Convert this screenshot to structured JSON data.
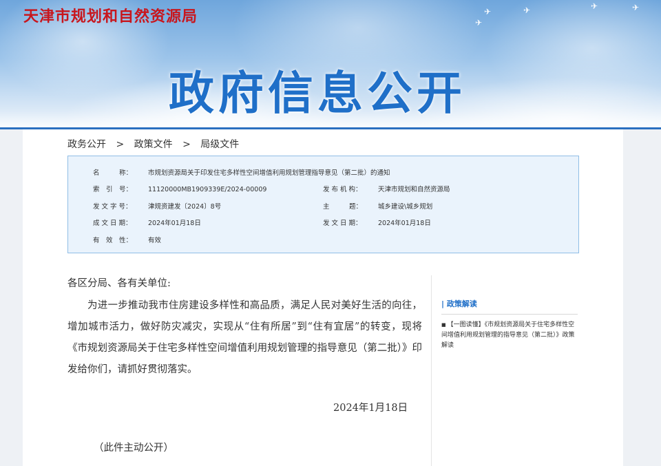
{
  "header": {
    "site_name": "天津市规划和自然资源局",
    "banner_title": "政府信息公开"
  },
  "breadcrumb": {
    "items": [
      "政务公开",
      "政策文件",
      "局级文件"
    ],
    "separator": ">"
  },
  "meta": {
    "name_label": "名　　　称：",
    "name_value": "市规划资源局关于印发住宅多样性空间增值利用规划管理指导意见（第二批）的通知",
    "index_label": "索　引　号：",
    "index_value": "11120000MB1909339E/2024-00009",
    "issuer_label": "发 布 机 构：",
    "issuer_value": "天津市规划和自然资源局",
    "docno_label": "发 文 字 号：",
    "docno_value": "津规资建发〔2024〕8号",
    "subject_label": "主　　　题：",
    "subject_value": "城乡建设\\城乡规划",
    "written_label": "成 文 日 期：",
    "written_value": "2024年01月18日",
    "issued_label": "发 文 日 期：",
    "issued_value": "2024年01月18日",
    "validity_label": "有　效　性：",
    "validity_value": "有效"
  },
  "document": {
    "greeting": "各区分局、各有关单位:",
    "body": "为进一步推动我市住房建设多样性和高品质，满足人民对美好生活的向往，增加城市活力，做好防灾减灾，实现从“住有所居”到“住有宜居”的转变，现将《市规划资源局关于住宅多样性空间增值利用规划管理的指导意见（第二批）》印发给你们，请抓好贯彻落实。",
    "date": "2024年1月18日",
    "public_note": "（此件主动公开）"
  },
  "sidebar": {
    "title": "| 政策解读",
    "item": "【一图读懂】《市规划资源局关于住宅多样性空间增值利用规划管理的指导意见（第二批）》政策解读"
  },
  "colors": {
    "site_name_red": "#c8161d",
    "title_blue": "#1f6fc8",
    "meta_bg": "#eaf3fc",
    "meta_border": "#8fbde6"
  }
}
